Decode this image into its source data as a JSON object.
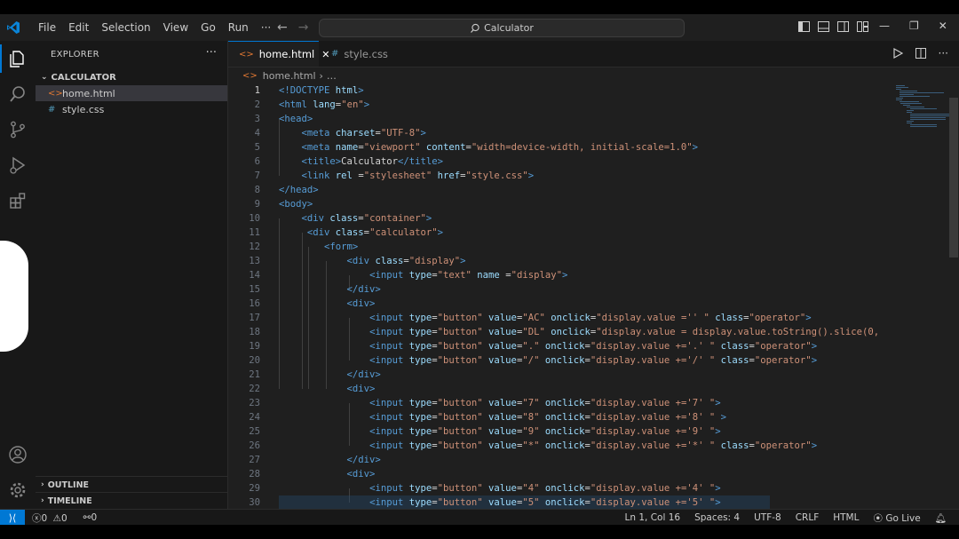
{
  "window": {
    "menu": [
      "File",
      "Edit",
      "Selection",
      "View",
      "Go",
      "Run",
      "···"
    ],
    "search_text": "Calculator"
  },
  "sidebar": {
    "title": "EXPLORER",
    "more": "···",
    "folder": "CALCULATOR",
    "files": [
      {
        "name": "home.html",
        "icon": "<>",
        "icon_color": "#e37933",
        "selected": true
      },
      {
        "name": "style.css",
        "icon": "#",
        "icon_color": "#519aba",
        "selected": false
      }
    ],
    "outline": "OUTLINE",
    "timeline": "TIMELINE"
  },
  "tabs": [
    {
      "label": "home.html",
      "icon": "<>",
      "icon_color": "#e37933",
      "active": true,
      "close": "✕"
    },
    {
      "label": "style.css",
      "icon": "#",
      "icon_color": "#519aba",
      "active": false
    }
  ],
  "breadcrumb": {
    "file": "home.html",
    "rest": "…"
  },
  "editor": {
    "current_line": 1,
    "lines": [
      [
        [
          "tag",
          "<!DOCTYPE "
        ],
        [
          "attr",
          "html"
        ],
        [
          "tag",
          ">"
        ]
      ],
      [
        [
          "tag",
          "<html "
        ],
        [
          "attr",
          "lang"
        ],
        [
          "txt",
          "="
        ],
        [
          "str",
          "\"en\""
        ],
        [
          "tag",
          ">"
        ]
      ],
      [
        [
          "tag",
          "<head>"
        ]
      ],
      [
        [
          "txt",
          "    "
        ],
        [
          "tag",
          "<meta "
        ],
        [
          "attr",
          "charset"
        ],
        [
          "txt",
          "="
        ],
        [
          "str",
          "\"UTF-8\""
        ],
        [
          "tag",
          ">"
        ]
      ],
      [
        [
          "txt",
          "    "
        ],
        [
          "tag",
          "<meta "
        ],
        [
          "attr",
          "name"
        ],
        [
          "txt",
          "="
        ],
        [
          "str",
          "\"viewport\""
        ],
        [
          "txt",
          " "
        ],
        [
          "attr",
          "content"
        ],
        [
          "txt",
          "="
        ],
        [
          "str",
          "\"width=device-width, initial-scale=1.0\""
        ],
        [
          "tag",
          ">"
        ]
      ],
      [
        [
          "txt",
          "    "
        ],
        [
          "tag",
          "<title>"
        ],
        [
          "txt",
          "Calculator"
        ],
        [
          "tag",
          "</title>"
        ]
      ],
      [
        [
          "txt",
          "    "
        ],
        [
          "tag",
          "<link "
        ],
        [
          "attr",
          "rel"
        ],
        [
          "txt",
          " ="
        ],
        [
          "str",
          "\"stylesheet\""
        ],
        [
          "txt",
          " "
        ],
        [
          "attr",
          "href"
        ],
        [
          "txt",
          "="
        ],
        [
          "str",
          "\"style.css\""
        ],
        [
          "tag",
          ">"
        ]
      ],
      [
        [
          "tag",
          "</head>"
        ]
      ],
      [
        [
          "tag",
          "<body>"
        ]
      ],
      [
        [
          "txt",
          "    "
        ],
        [
          "tag",
          "<div "
        ],
        [
          "attr",
          "class"
        ],
        [
          "txt",
          "="
        ],
        [
          "str",
          "\"container\""
        ],
        [
          "tag",
          ">"
        ]
      ],
      [
        [
          "txt",
          "     "
        ],
        [
          "tag",
          "<div "
        ],
        [
          "attr",
          "class"
        ],
        [
          "txt",
          "="
        ],
        [
          "str",
          "\"calculator\""
        ],
        [
          "tag",
          ">"
        ]
      ],
      [
        [
          "txt",
          "        "
        ],
        [
          "tag",
          "<form>"
        ]
      ],
      [
        [
          "txt",
          "            "
        ],
        [
          "tag",
          "<div "
        ],
        [
          "attr",
          "class"
        ],
        [
          "txt",
          "="
        ],
        [
          "str",
          "\"display\""
        ],
        [
          "tag",
          ">"
        ]
      ],
      [
        [
          "txt",
          "                "
        ],
        [
          "tag",
          "<input "
        ],
        [
          "attr",
          "type"
        ],
        [
          "txt",
          "="
        ],
        [
          "str",
          "\"text\""
        ],
        [
          "txt",
          " "
        ],
        [
          "attr",
          "name"
        ],
        [
          "txt",
          " ="
        ],
        [
          "str",
          "\"display\""
        ],
        [
          "tag",
          ">"
        ]
      ],
      [
        [
          "txt",
          "            "
        ],
        [
          "tag",
          "</div>"
        ]
      ],
      [
        [
          "txt",
          "            "
        ],
        [
          "tag",
          "<div>"
        ]
      ],
      [
        [
          "txt",
          "                "
        ],
        [
          "tag",
          "<input "
        ],
        [
          "attr",
          "type"
        ],
        [
          "txt",
          "="
        ],
        [
          "str",
          "\"button\""
        ],
        [
          "txt",
          " "
        ],
        [
          "attr",
          "value"
        ],
        [
          "txt",
          "="
        ],
        [
          "str",
          "\"AC\""
        ],
        [
          "txt",
          " "
        ],
        [
          "attr",
          "onclick"
        ],
        [
          "txt",
          "="
        ],
        [
          "str",
          "\"display.value ='' \""
        ],
        [
          "txt",
          " "
        ],
        [
          "attr",
          "class"
        ],
        [
          "txt",
          "="
        ],
        [
          "str",
          "\"operator\""
        ],
        [
          "tag",
          ">"
        ]
      ],
      [
        [
          "txt",
          "                "
        ],
        [
          "tag",
          "<input "
        ],
        [
          "attr",
          "type"
        ],
        [
          "txt",
          "="
        ],
        [
          "str",
          "\"button\""
        ],
        [
          "txt",
          " "
        ],
        [
          "attr",
          "value"
        ],
        [
          "txt",
          "="
        ],
        [
          "str",
          "\"DL\""
        ],
        [
          "txt",
          " "
        ],
        [
          "attr",
          "onclick"
        ],
        [
          "txt",
          "="
        ],
        [
          "str",
          "\"display.value = display.value.toString().slice(0,"
        ]
      ],
      [
        [
          "txt",
          "                "
        ],
        [
          "tag",
          "<input "
        ],
        [
          "attr",
          "type"
        ],
        [
          "txt",
          "="
        ],
        [
          "str",
          "\"button\""
        ],
        [
          "txt",
          " "
        ],
        [
          "attr",
          "value"
        ],
        [
          "txt",
          "="
        ],
        [
          "str",
          "\".\""
        ],
        [
          "txt",
          " "
        ],
        [
          "attr",
          "onclick"
        ],
        [
          "txt",
          "="
        ],
        [
          "str",
          "\"display.value +='.' \""
        ],
        [
          "txt",
          " "
        ],
        [
          "attr",
          "class"
        ],
        [
          "txt",
          "="
        ],
        [
          "str",
          "\"operator\""
        ],
        [
          "tag",
          ">"
        ]
      ],
      [
        [
          "txt",
          "                "
        ],
        [
          "tag",
          "<input "
        ],
        [
          "attr",
          "type"
        ],
        [
          "txt",
          "="
        ],
        [
          "str",
          "\"button\""
        ],
        [
          "txt",
          " "
        ],
        [
          "attr",
          "value"
        ],
        [
          "txt",
          "="
        ],
        [
          "str",
          "\"/\""
        ],
        [
          "txt",
          " "
        ],
        [
          "attr",
          "onclick"
        ],
        [
          "txt",
          "="
        ],
        [
          "str",
          "\"display.value +='/' \""
        ],
        [
          "txt",
          " "
        ],
        [
          "attr",
          "class"
        ],
        [
          "txt",
          "="
        ],
        [
          "str",
          "\"operator\""
        ],
        [
          "tag",
          ">"
        ]
      ],
      [
        [
          "txt",
          "            "
        ],
        [
          "tag",
          "</div>"
        ]
      ],
      [
        [
          "txt",
          "            "
        ],
        [
          "tag",
          "<div>"
        ]
      ],
      [
        [
          "txt",
          "                "
        ],
        [
          "tag",
          "<input "
        ],
        [
          "attr",
          "type"
        ],
        [
          "txt",
          "="
        ],
        [
          "str",
          "\"button\""
        ],
        [
          "txt",
          " "
        ],
        [
          "attr",
          "value"
        ],
        [
          "txt",
          "="
        ],
        [
          "str",
          "\"7\""
        ],
        [
          "txt",
          " "
        ],
        [
          "attr",
          "onclick"
        ],
        [
          "txt",
          "="
        ],
        [
          "str",
          "\"display.value +='7' \""
        ],
        [
          "tag",
          ">"
        ]
      ],
      [
        [
          "txt",
          "                "
        ],
        [
          "tag",
          "<input "
        ],
        [
          "attr",
          "type"
        ],
        [
          "txt",
          "="
        ],
        [
          "str",
          "\"button\""
        ],
        [
          "txt",
          " "
        ],
        [
          "attr",
          "value"
        ],
        [
          "txt",
          "="
        ],
        [
          "str",
          "\"8\""
        ],
        [
          "txt",
          " "
        ],
        [
          "attr",
          "onclick"
        ],
        [
          "txt",
          "="
        ],
        [
          "str",
          "\"display.value +='8' \""
        ],
        [
          "txt",
          " "
        ],
        [
          "tag",
          ">"
        ]
      ],
      [
        [
          "txt",
          "                "
        ],
        [
          "tag",
          "<input "
        ],
        [
          "attr",
          "type"
        ],
        [
          "txt",
          "="
        ],
        [
          "str",
          "\"button\""
        ],
        [
          "txt",
          " "
        ],
        [
          "attr",
          "value"
        ],
        [
          "txt",
          "="
        ],
        [
          "str",
          "\"9\""
        ],
        [
          "txt",
          " "
        ],
        [
          "attr",
          "onclick"
        ],
        [
          "txt",
          "="
        ],
        [
          "str",
          "\"display.value +='9' \""
        ],
        [
          "tag",
          ">"
        ]
      ],
      [
        [
          "txt",
          "                "
        ],
        [
          "tag",
          "<input "
        ],
        [
          "attr",
          "type"
        ],
        [
          "txt",
          "="
        ],
        [
          "str",
          "\"button\""
        ],
        [
          "txt",
          " "
        ],
        [
          "attr",
          "value"
        ],
        [
          "txt",
          "="
        ],
        [
          "str",
          "\"*\""
        ],
        [
          "txt",
          " "
        ],
        [
          "attr",
          "onclick"
        ],
        [
          "txt",
          "="
        ],
        [
          "str",
          "\"display.value +='*' \""
        ],
        [
          "txt",
          " "
        ],
        [
          "attr",
          "class"
        ],
        [
          "txt",
          "="
        ],
        [
          "str",
          "\"operator\""
        ],
        [
          "tag",
          ">"
        ]
      ],
      [
        [
          "txt",
          "            "
        ],
        [
          "tag",
          "</div>"
        ]
      ],
      [
        [
          "txt",
          "            "
        ],
        [
          "tag",
          "<div>"
        ]
      ],
      [
        [
          "txt",
          "                "
        ],
        [
          "tag",
          "<input "
        ],
        [
          "attr",
          "type"
        ],
        [
          "txt",
          "="
        ],
        [
          "str",
          "\"button\""
        ],
        [
          "txt",
          " "
        ],
        [
          "attr",
          "value"
        ],
        [
          "txt",
          "="
        ],
        [
          "str",
          "\"4\""
        ],
        [
          "txt",
          " "
        ],
        [
          "attr",
          "onclick"
        ],
        [
          "txt",
          "="
        ],
        [
          "str",
          "\"display.value +='4' \""
        ],
        [
          "tag",
          ">"
        ]
      ],
      [
        [
          "txt",
          "                "
        ],
        [
          "tag",
          "<input "
        ],
        [
          "attr",
          "type"
        ],
        [
          "txt",
          "="
        ],
        [
          "str",
          "\"button\""
        ],
        [
          "txt",
          " "
        ],
        [
          "attr",
          "value"
        ],
        [
          "txt",
          "="
        ],
        [
          "str",
          "\"5\""
        ],
        [
          "txt",
          " "
        ],
        [
          "attr",
          "onclick"
        ],
        [
          "txt",
          "="
        ],
        [
          "str",
          "\"display.value +='5' \""
        ],
        [
          "tag",
          ">"
        ]
      ]
    ]
  },
  "status": {
    "errors": "0",
    "warnings": "0",
    "ports": "0",
    "position": "Ln 1, Col 16",
    "spaces": "Spaces: 4",
    "encoding": "UTF-8",
    "eol": "CRLF",
    "language": "HTML",
    "golive": "Go Live"
  },
  "colors": {
    "accent": "#0078d4",
    "html_icon": "#e37933",
    "css_icon": "#519aba"
  }
}
